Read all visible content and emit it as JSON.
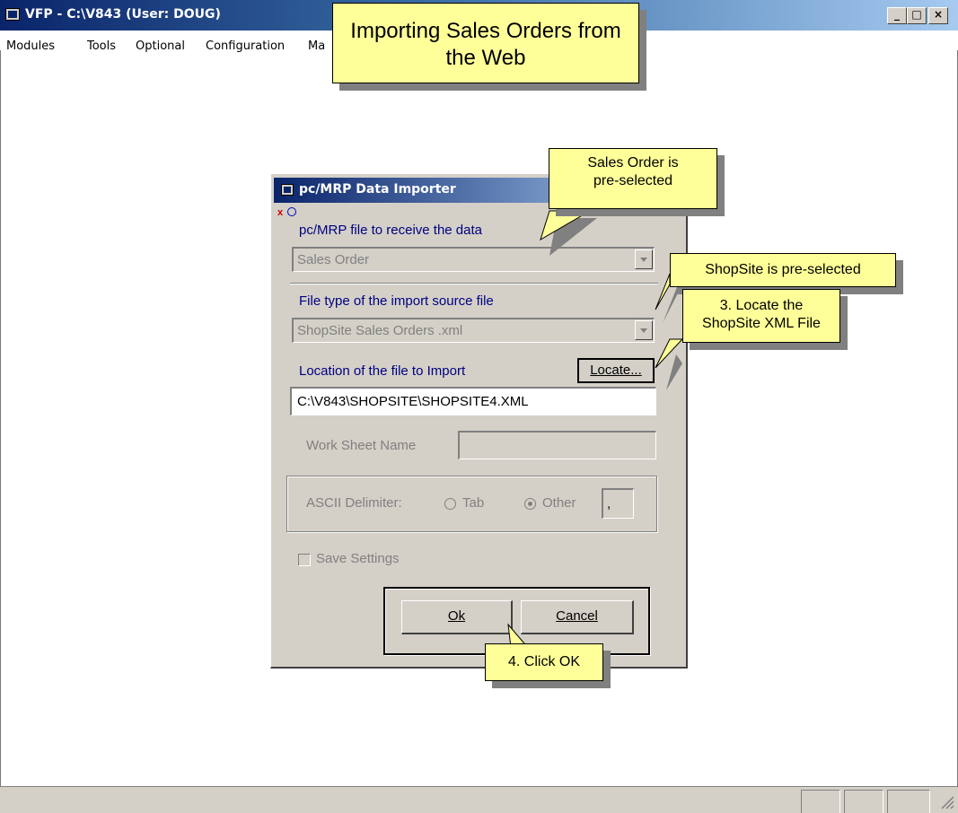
{
  "window": {
    "title": "VFP - C:\\V843  (User: DOUG)",
    "controls": [
      "_",
      "□",
      "×"
    ]
  },
  "menu": {
    "items": [
      "Modules",
      "Tools",
      "Optional",
      "Configuration",
      "Ma"
    ]
  },
  "dialog": {
    "title": "pc/MRP Data Importer",
    "receive_label": "pc/MRP file to receive the data",
    "receive_value": "Sales Order",
    "filetype_label": "File type of the import source file",
    "filetype_value": "ShopSite Sales Orders .xml",
    "location_label": "Location of the file to Import",
    "locate_button": "Locate...",
    "file_path": "C:\\V843\\SHOPSITE\\SHOPSITE4.XML",
    "worksheet_label": "Work Sheet Name",
    "worksheet_value": "",
    "delimiter_label": "ASCII Delimiter:",
    "delimiter_tab": "Tab",
    "delimiter_other": "Other",
    "delimiter_char": ",",
    "save_settings": "Save Settings",
    "ok_button": "Ok",
    "cancel_button": "Cancel"
  },
  "callouts": {
    "heading": "Importing Sales Orders from the Web",
    "sales_order": "Sales Order is pre-selected",
    "shopsite": "ShopSite is pre-selected",
    "locate": "3. Locate the ShopSite XML File",
    "click_ok": "4. Click OK"
  },
  "colors": {
    "titlebar_start": "#0a246a",
    "titlebar_end": "#a6caf0",
    "face": "#d4d0c8",
    "callout": "#ffff99",
    "label_blue": "#000080"
  }
}
